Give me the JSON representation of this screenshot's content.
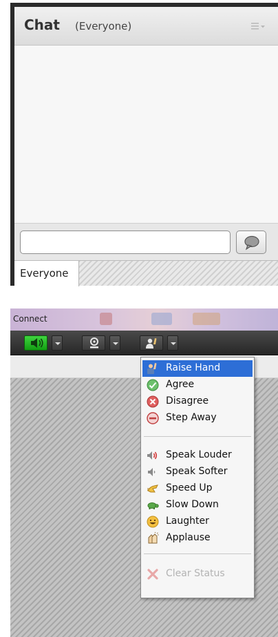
{
  "chat": {
    "title": "Chat",
    "subtitle": "(Everyone)",
    "input_value": "",
    "tab_label": "Everyone"
  },
  "connect": {
    "window_title": "Connect",
    "audio_active_color": "#2fc42f"
  },
  "status_menu": {
    "selected_item": "Raise Hand",
    "accent_color": "#2d6ed6",
    "items_group1": [
      {
        "label": "Raise Hand",
        "icon": "raise-hand-icon"
      },
      {
        "label": "Agree",
        "icon": "agree-check-icon"
      },
      {
        "label": "Disagree",
        "icon": "disagree-x-icon"
      },
      {
        "label": "Step Away",
        "icon": "step-away-icon"
      }
    ],
    "items_group2": [
      {
        "label": "Speak Louder",
        "icon": "speak-louder-icon"
      },
      {
        "label": "Speak Softer",
        "icon": "speak-softer-icon"
      },
      {
        "label": "Speed Up",
        "icon": "speed-up-icon"
      },
      {
        "label": "Slow Down",
        "icon": "slow-down-turtle-icon"
      },
      {
        "label": "Laughter",
        "icon": "laughter-smiley-icon"
      },
      {
        "label": "Applause",
        "icon": "applause-icon"
      }
    ],
    "clear_status": {
      "label": "Clear Status",
      "icon": "clear-status-icon"
    }
  }
}
